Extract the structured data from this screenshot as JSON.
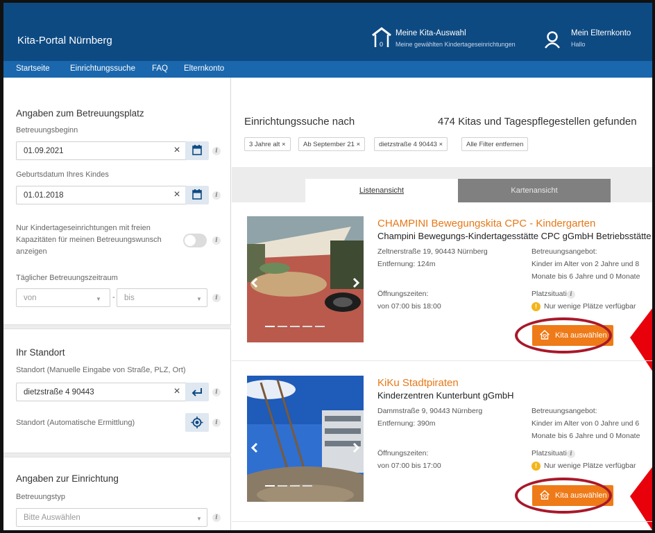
{
  "header": {
    "portal_title": "Kita-Portal Nürnberg",
    "selection_title": "Meine Kita-Auswahl",
    "selection_sub": "Meine gewählten Kindertageseinrichtungen",
    "selection_count": "0",
    "account_title": "Mein Elternkonto",
    "account_sub": "Hallo"
  },
  "nav": [
    "Startseite",
    "Einrichtungssuche",
    "FAQ",
    "Elternkonto"
  ],
  "sidebar": {
    "care_heading": "Angaben zum Betreuungsplatz",
    "start_label": "Betreuungsbeginn",
    "start_value": "01.09.2021",
    "birth_label": "Geburtsdatum Ihres Kindes",
    "birth_value": "01.01.2018",
    "free_only_label": "Nur Kindertageseinrichtungen mit freien Kapazitäten für meinen Betreuungswunsch anzeigen",
    "daily_label": "Täglicher Betreuungszeitraum",
    "from_placeholder": "von",
    "range_sep": "-",
    "to_placeholder": "bis",
    "location_heading": "Ihr Standort",
    "location_label": "Standort (Manuelle Eingabe von Straße, PLZ, Ort)",
    "location_value": "dietzstraße 4 90443",
    "auto_location_label": "Standort (Automatische Ermittlung)",
    "facility_heading": "Angaben zur Einrichtung",
    "type_label": "Betreuungstyp",
    "type_placeholder": "Bitte Auswählen",
    "clear_symbol": "×",
    "info_symbol": "i"
  },
  "main": {
    "search_heading": "Einrichtungssuche nach",
    "result_count": "474 Kitas und Tagespflegestellen gefunden",
    "chips": [
      "3 Jahre alt ×",
      "Ab September 21 ×",
      "dietzstraße 4 90443 ×",
      "Alle Filter entfernen"
    ],
    "tabs": [
      "Listenansicht",
      "Kartenansicht"
    ],
    "results": [
      {
        "title": "CHAMPINI Bewegungskita CPC - Kindergarten",
        "org": "Champini Bewegungs-Kindertagesstätte CPC gGmbH Betriebsstätte CPC",
        "address": "Zeltnerstraße 19, 90443 Nürnberg",
        "distance": "Entfernung: 124m",
        "hours_label": "Öffnungszeiten:",
        "hours": "von 07:00 bis 18:00",
        "offer_label": "Betreuungsangebot:",
        "offer_line1": "Kinder im Alter von 2 Jahre und 8",
        "offer_line2": "Monate bis 6 Jahre und 0 Monate",
        "places_label": "Platzsituation",
        "places_status": "Nur wenige Plätze verfügbar",
        "select_label": "Kita auswählen"
      },
      {
        "title": "KiKu Stadtpiraten",
        "org": "Kinderzentren Kunterbunt gGmbH",
        "address": "Dammstraße 9, 90443 Nürnberg",
        "distance": "Entfernung: 390m",
        "hours_label": "Öffnungszeiten:",
        "hours": "von 07:00 bis 17:00",
        "offer_label": "Betreuungsangebot:",
        "offer_line1": "Kinder im Alter von 0 Jahre und 6",
        "offer_line2": "Monate bis 6 Jahre und 0 Monate",
        "places_label": "Platzsituation",
        "places_status": "Nur wenige Plätze verfügbar",
        "select_label": "Kita auswählen"
      }
    ]
  },
  "colors": {
    "header_blue": "#0e4a82",
    "nav_blue": "#1a67ad",
    "accent_orange": "#ef7a18",
    "annotation_red": "#e8000b"
  }
}
